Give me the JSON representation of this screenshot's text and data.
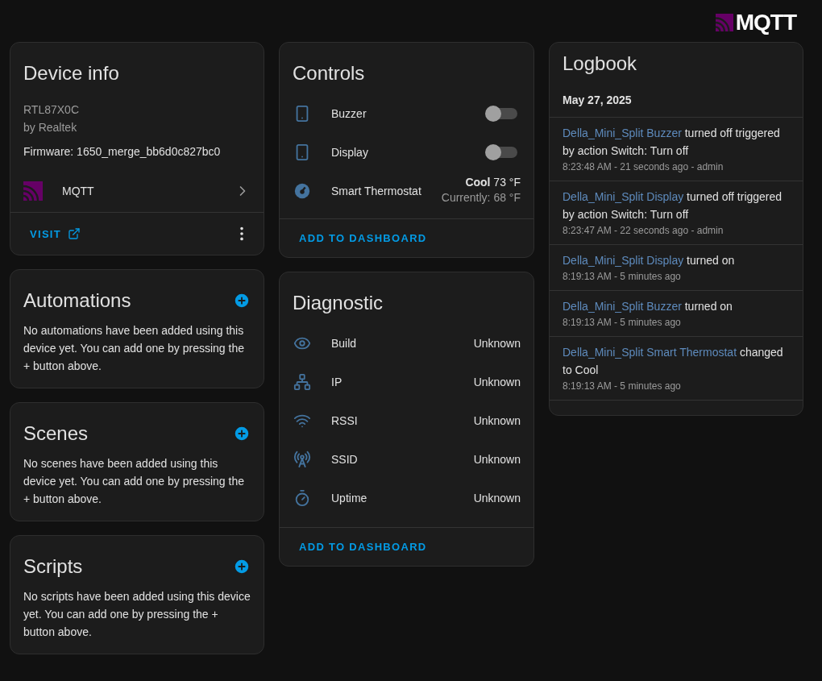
{
  "logo": {
    "text": "MQTT"
  },
  "device_info": {
    "title": "Device info",
    "model": "RTL87X0C",
    "manufacturer": "by Realtek",
    "firmware": "Firmware: 1650_merge_bb6d0c827bc0",
    "integration": "MQTT",
    "visit": "VISIT"
  },
  "sections": [
    {
      "title": "Automations",
      "text": "No automations have been added using this device yet. You can add one by pressing the + button above."
    },
    {
      "title": "Scenes",
      "text": "No scenes have been added using this device yet. You can add one by pressing the + button above."
    },
    {
      "title": "Scripts",
      "text": "No scripts have been added using this device yet. You can add one by pressing the + button above."
    }
  ],
  "controls": {
    "title": "Controls",
    "items": [
      {
        "kind": "switch",
        "name": "Buzzer",
        "on": false
      },
      {
        "kind": "switch",
        "name": "Display",
        "on": false
      },
      {
        "kind": "climate",
        "name": "Smart Thermostat",
        "state": "**Cool** 73 °F",
        "current": "Currently: 68 °F"
      }
    ],
    "action": "ADD TO DASHBOARD"
  },
  "diagnostic": {
    "title": "Diagnostic",
    "items": [
      {
        "name": "Build",
        "value": "Unknown"
      },
      {
        "name": "IP",
        "value": "Unknown"
      },
      {
        "name": "RSSI",
        "value": "Unknown"
      },
      {
        "name": "SSID",
        "value": "Unknown"
      },
      {
        "name": "Uptime",
        "value": "Unknown"
      }
    ],
    "action": "ADD TO DASHBOARD"
  },
  "logbook": {
    "title": "Logbook",
    "date": "May 27, 2025",
    "entries": [
      {
        "entity": "Della_Mini_Split Buzzer",
        "message": "turned off triggered by action Switch: Turn off",
        "meta": "8:23:48 AM - 21 seconds ago - admin"
      },
      {
        "entity": "Della_Mini_Split Display",
        "message": "turned off triggered by action Switch: Turn off",
        "meta": "8:23:47 AM - 22 seconds ago - admin"
      },
      {
        "entity": "Della_Mini_Split Display",
        "message": "turned on",
        "meta": "8:19:13 AM - 5 minutes ago"
      },
      {
        "entity": "Della_Mini_Split Buzzer",
        "message": "turned on",
        "meta": "8:19:13 AM - 5 minutes ago"
      },
      {
        "entity": "Della_Mini_Split Smart Thermostat",
        "message": "changed to Cool",
        "meta": "8:19:13 AM - 5 minutes ago"
      }
    ]
  }
}
